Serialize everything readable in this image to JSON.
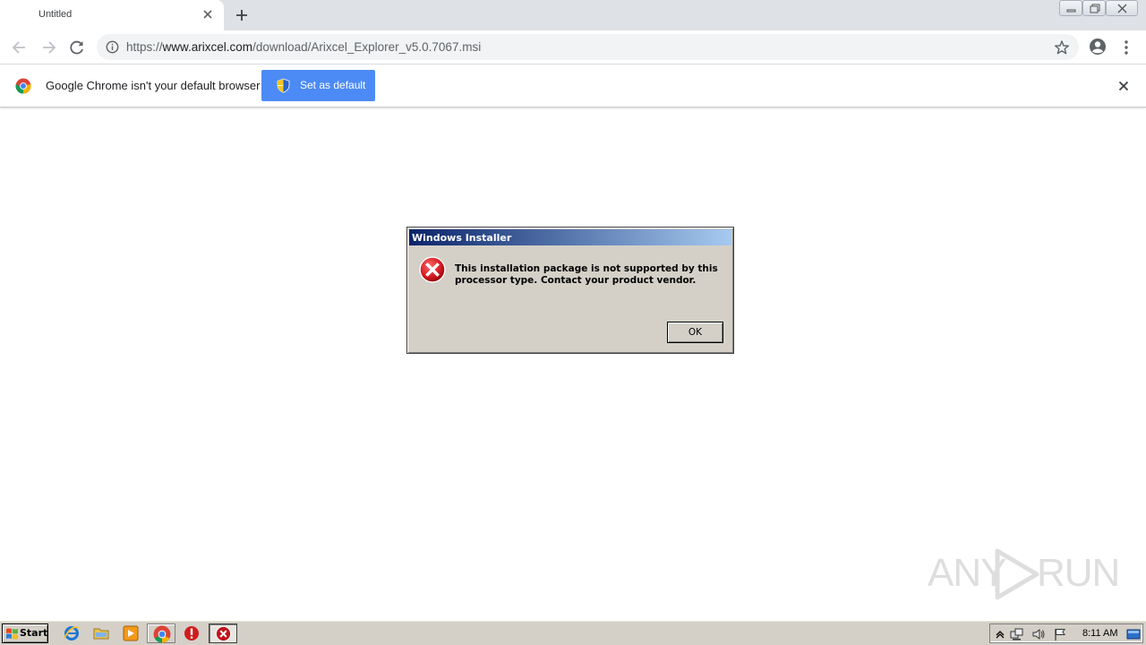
{
  "browser": {
    "tab": {
      "title": "Untitled"
    },
    "address_bar": {
      "url_prefix": "https://",
      "url_host": "www.arixcel.com",
      "url_path": "/download/Arixcel_Explorer_v5.0.7067.msi"
    },
    "infobar": {
      "message": "Google Chrome isn't your default browser",
      "button_label": "Set as default"
    }
  },
  "dialog": {
    "title": "Windows Installer",
    "message": "This installation package is not supported by this processor type. Contact your product vendor.",
    "ok_label": "OK",
    "icon": "error-icon"
  },
  "watermark": {
    "left": "ANY",
    "right": "RUN"
  },
  "taskbar": {
    "start_label": "Start",
    "pinned": [
      "internet-explorer-icon",
      "folder-icon",
      "media-player-icon",
      "chrome-icon",
      "stop-icon",
      "error-app-icon"
    ],
    "tray_icons": [
      "show-hidden-icon",
      "network-icon",
      "volume-icon",
      "flag-icon"
    ],
    "clock": "8:11 AM"
  },
  "colors": {
    "chrome_blue": "#4c8bf5",
    "dialog_face": "#d4d0c8",
    "title_dark": "#0a246a",
    "title_light": "#a6caf0",
    "error_red": "#c0141a"
  }
}
